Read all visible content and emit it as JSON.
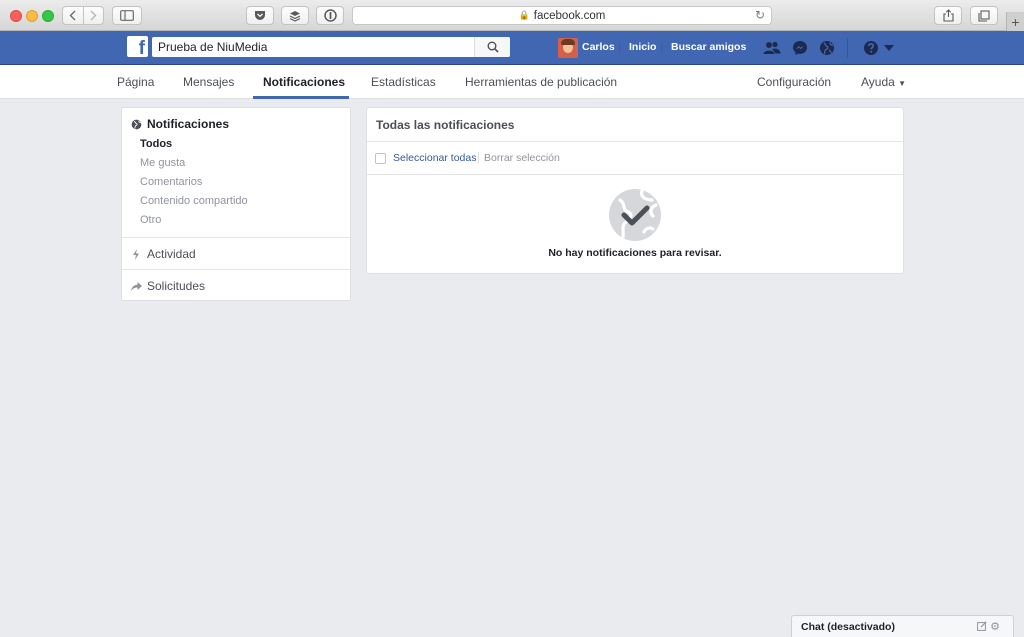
{
  "browser": {
    "url": "facebook.com"
  },
  "header": {
    "search_value": "Prueba de NiuMedia",
    "user_name": "Carlos",
    "home_label": "Inicio",
    "find_friends_label": "Buscar amigos",
    "brand_color": "#4267b2"
  },
  "page_nav": {
    "items": [
      {
        "label": "Página"
      },
      {
        "label": "Mensajes"
      },
      {
        "label": "Notificaciones"
      },
      {
        "label": "Estadísticas"
      },
      {
        "label": "Herramientas de publicación"
      }
    ],
    "active": "Notificaciones",
    "settings_label": "Configuración",
    "help_label": "Ayuda"
  },
  "sidebar": {
    "title": "Notificaciones",
    "sub_items": [
      {
        "label": "Todos"
      },
      {
        "label": "Me gusta"
      },
      {
        "label": "Comentarios"
      },
      {
        "label": "Contenido compartido"
      },
      {
        "label": "Otro"
      }
    ],
    "activity_label": "Actividad",
    "requests_label": "Solicitudes"
  },
  "main": {
    "title": "Todas las notificaciones",
    "select_all_label": "Seleccionar todas",
    "clear_selection_label": "Borrar selección",
    "empty_message": "No hay notificaciones para revisar."
  },
  "chat": {
    "label": "Chat (desactivado)"
  }
}
